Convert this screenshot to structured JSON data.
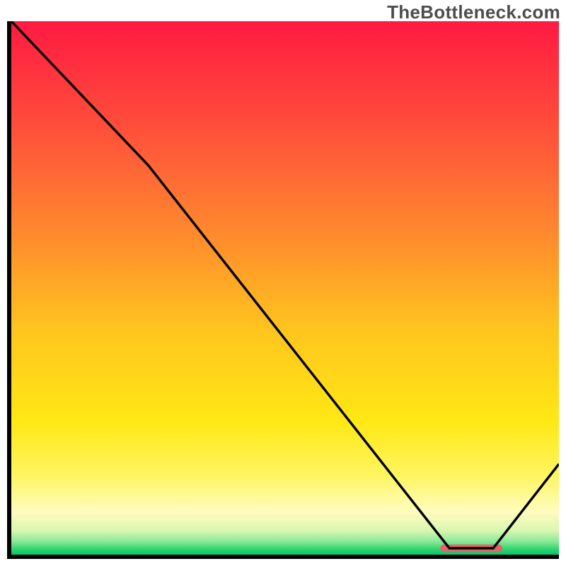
{
  "watermark": "TheBottleneck.com",
  "chart_data": {
    "type": "line",
    "title": "",
    "xlabel": "",
    "ylabel": "",
    "xlim": [
      0,
      100
    ],
    "ylim": [
      0,
      100
    ],
    "series": [
      {
        "name": "curve",
        "x": [
          0,
          25,
          80,
          88,
          100
        ],
        "y": [
          100,
          73,
          1.2,
          1.2,
          17
        ]
      }
    ],
    "highlight_segment": {
      "x_start": 79,
      "x_end": 89,
      "y": 1.2
    },
    "background_gradient": {
      "stops": [
        {
          "offset": 0.0,
          "color": "#ff1a42"
        },
        {
          "offset": 0.2,
          "color": "#ff4f3a"
        },
        {
          "offset": 0.4,
          "color": "#ff8a2e"
        },
        {
          "offset": 0.58,
          "color": "#ffc51e"
        },
        {
          "offset": 0.75,
          "color": "#ffe814"
        },
        {
          "offset": 0.85,
          "color": "#fff55f"
        },
        {
          "offset": 0.92,
          "color": "#fffcbf"
        },
        {
          "offset": 0.955,
          "color": "#d9f6b0"
        },
        {
          "offset": 0.975,
          "color": "#8ce99a"
        },
        {
          "offset": 0.99,
          "color": "#2fd36b"
        },
        {
          "offset": 1.0,
          "color": "#00c776"
        }
      ]
    },
    "highlight_color": "#e06666",
    "curve_color": "#000000"
  }
}
